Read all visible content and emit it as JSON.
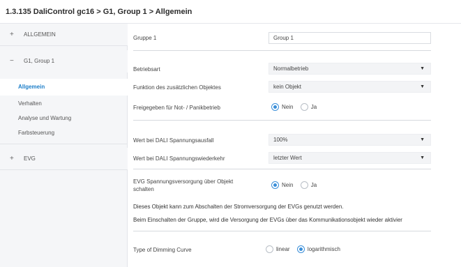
{
  "breadcrumb": "1.3.135 DaliControl gc16 > G1, Group 1 > Allgemein",
  "sidebar": {
    "groups": [
      {
        "symbol": "+",
        "label": "ALLGEMEIN"
      },
      {
        "symbol": "−",
        "label": "G1, Group 1"
      },
      {
        "symbol": "+",
        "label": "EVG"
      }
    ],
    "items": [
      {
        "label": "Allgemein",
        "active": true
      },
      {
        "label": "Verhalten"
      },
      {
        "label": "Analyse und Wartung"
      },
      {
        "label": "Farbsteuerung"
      }
    ]
  },
  "form": {
    "gruppe_label": "Gruppe 1",
    "gruppe_value": "Group 1",
    "betriebsart_label": "Betriebsart",
    "betriebsart_value": "Normalbetrieb",
    "funktion_label": "Funktion des zusätzlichen Objektes",
    "funktion_value": "kein Objekt",
    "freigegeben_label": "Freigegeben für Not- / Panikbetrieb",
    "freigegeben_options": [
      "Nein",
      "Ja"
    ],
    "freigegeben_selected": "Nein",
    "spannungsausfall_label": "Wert bei DALI Spannungsausfall",
    "spannungsausfall_value": "100%",
    "wiederkehr_label": "Wert bei DALI Spannungswiederkehr",
    "wiederkehr_value": "letzter Wert",
    "evg_label_line1": "EVG Spannungsversorgung über Objekt",
    "evg_label_line2": "schalten",
    "evg_options": [
      "Nein",
      "Ja"
    ],
    "evg_selected": "Nein",
    "info1": "Dieses Objekt kann zum Abschalten der Stromversorgung der EVGs genutzt werden.",
    "info2": "Beim Einschalten der Gruppe, wird die Versorgung der EVGs über das Kommunikationsobjekt wieder aktivier",
    "dimming_label": "Type of Dimming Curve",
    "dimming_options": [
      "linear",
      "logarithmisch"
    ],
    "dimming_selected": "logarithmisch"
  },
  "colors": {
    "accent": "#3b8fd9",
    "active_text": "#1e7fc9"
  },
  "icons": {
    "dropdown": "chevron-down-icon",
    "expand": "plus-icon",
    "collapse": "minus-icon"
  }
}
